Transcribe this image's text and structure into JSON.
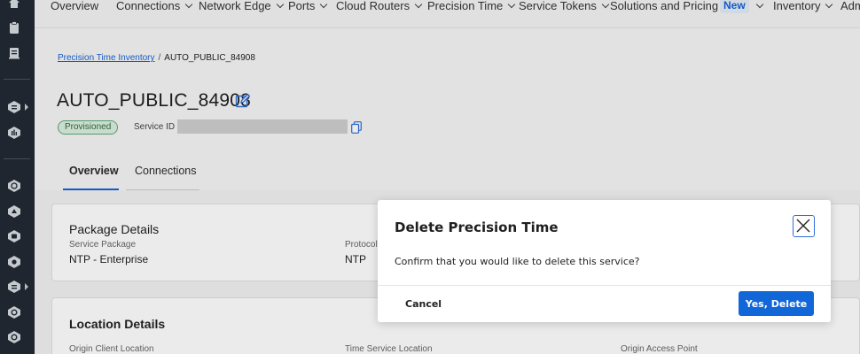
{
  "topnav": {
    "items": [
      "Overview",
      "Connections",
      "Network Edge",
      "Ports",
      "Cloud Routers",
      "Precision Time",
      "Service Tokens",
      "Solutions and Pricing",
      "Inventory",
      "Adm"
    ],
    "new_badge": "New"
  },
  "breadcrumb": {
    "root": "Precision Time Inventory",
    "separator": "/",
    "current": "AUTO_PUBLIC_84908"
  },
  "page": {
    "title": "AUTO_PUBLIC_84908",
    "status": "Provisioned",
    "service_id_label": "Service ID"
  },
  "tabs": [
    "Overview",
    "Connections"
  ],
  "package_card": {
    "heading": "Package Details",
    "service_package_label": "Service Package",
    "service_package_value": "NTP - Enterprise",
    "protocol_label": "Protocol",
    "protocol_value": "NTP"
  },
  "location_card": {
    "heading": "Location Details",
    "origin_client_location_label": "Origin Client Location",
    "time_service_location_label": "Time Service Location",
    "origin_access_point_label": "Origin Access Point"
  },
  "modal": {
    "title": "Delete Precision Time",
    "message": "Confirm that you would like to delete this service?",
    "cancel_label": "Cancel",
    "confirm_label": "Yes, Delete"
  },
  "colors": {
    "accent": "#1763d6",
    "rail_bg": "#222a33",
    "status_bg": "#dcefe0"
  },
  "icons": {
    "edit": "pencil-edit-icon",
    "copy": "copy-icon",
    "close": "close-icon"
  }
}
